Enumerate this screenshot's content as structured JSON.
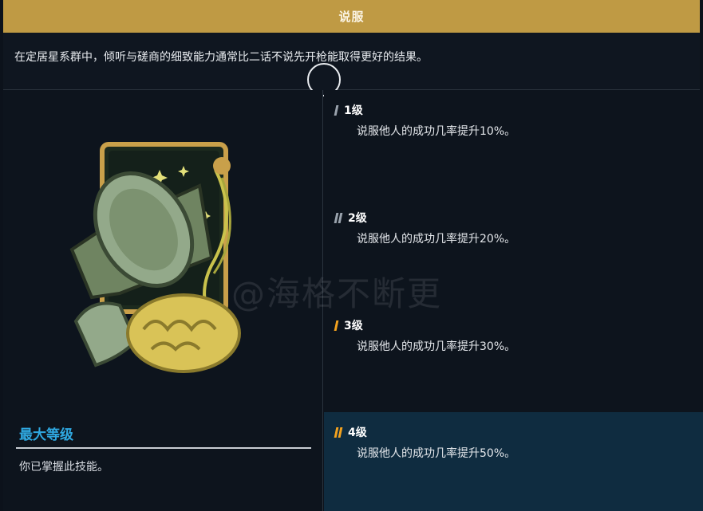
{
  "header": {
    "title": "说服"
  },
  "description": "在定居星系群中，倾听与磋商的细致能力通常比二话不说先开枪能取得更好的结果。",
  "left": {
    "max_title": "最大等级",
    "max_text": "你已掌握此技能。"
  },
  "ranks": [
    {
      "label": "1级",
      "desc": "说服他人的成功几率提升10%。",
      "bars": 1,
      "accent": "gray",
      "selected": false
    },
    {
      "label": "2级",
      "desc": "说服他人的成功几率提升20%。",
      "bars": 2,
      "accent": "gray",
      "selected": false
    },
    {
      "label": "3级",
      "desc": "说服他人的成功几率提升30%。",
      "bars": 1,
      "accent": "orange",
      "selected": false
    },
    {
      "label": "4级",
      "desc": "说服他人的成功几率提升50%。",
      "bars": 2,
      "accent": "orange",
      "selected": true
    }
  ],
  "watermark": "@海格不断更",
  "colors": {
    "title_bar": "#bf9a44",
    "accent_blue": "#2fa8e0",
    "accent_orange": "#f3a21e",
    "selected_bg": "#0f2c40"
  }
}
